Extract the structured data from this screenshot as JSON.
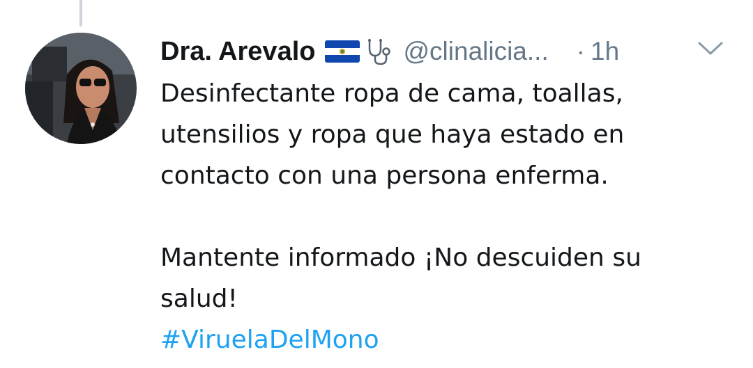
{
  "tweet": {
    "author_name": "Dra. Arevalo",
    "name_emojis": [
      "el-salvador-flag-icon",
      "stethoscope-icon"
    ],
    "handle": "@clinalicia...",
    "separator": "·",
    "time": "1h",
    "text_lines": [
      "Desinfectante ropa de cama, toallas,",
      "utensilios y ropa que haya estado en",
      "contacto con una persona enferma.",
      "",
      "Mantente informado ¡No descuiden su",
      "salud!"
    ],
    "hashtag": "#ViruelaDelMono"
  },
  "colors": {
    "text": "#14171a",
    "secondary": "#657786",
    "link": "#1da1f2",
    "thread_line": "#cdd3d8"
  }
}
